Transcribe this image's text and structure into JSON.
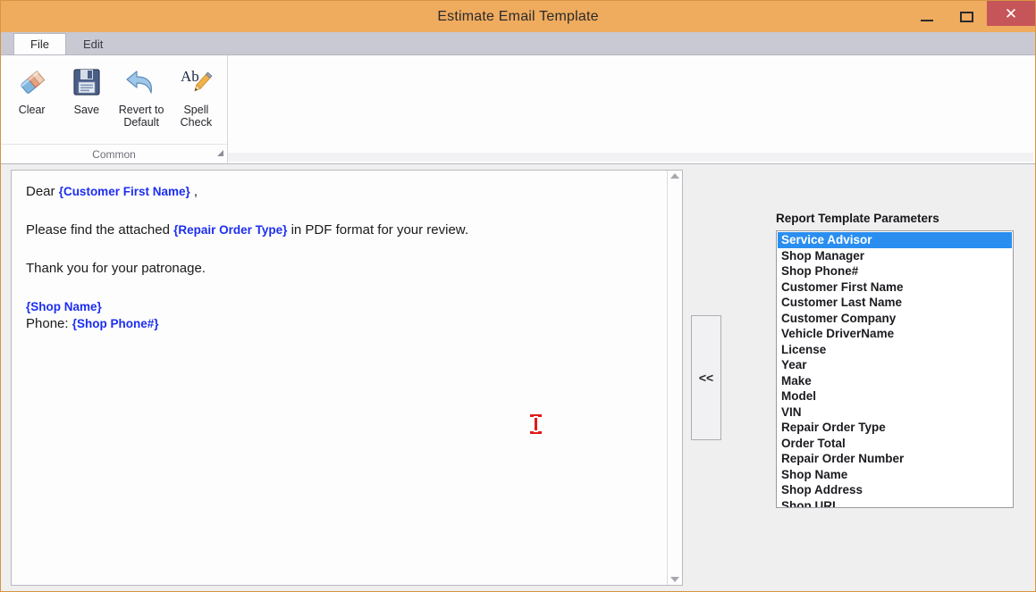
{
  "window": {
    "title": "Estimate Email Template",
    "controls": {
      "minimize": "minimize-button",
      "maximize": "maximize-button",
      "close_label": "✕"
    },
    "frame_color": "#efab5e"
  },
  "ribbon": {
    "tabs": [
      {
        "label": "File",
        "active": true
      },
      {
        "label": "Edit",
        "active": false
      }
    ],
    "group": {
      "label": "Common",
      "buttons": [
        {
          "label": "Clear",
          "icon": "eraser-icon"
        },
        {
          "label": "Save",
          "icon": "floppy-disk-icon"
        },
        {
          "label": "Revert to Default",
          "label_line1": "Revert to",
          "label_line2": "Default",
          "icon": "undo-arrow-icon"
        },
        {
          "label": "Spell Check",
          "label_line1": "Spell",
          "label_line2": "Check",
          "icon": "spell-check-icon"
        }
      ]
    }
  },
  "editor": {
    "paragraphs": [
      {
        "runs": [
          {
            "text": "Dear ",
            "token": false
          },
          {
            "text": "{Customer First Name}",
            "token": true
          },
          {
            "text": " ,",
            "token": false
          }
        ]
      },
      {
        "runs": [
          {
            "text": "Please find the attached ",
            "token": false
          },
          {
            "text": "{Repair Order Type}",
            "token": true
          },
          {
            "text": "  in PDF format for your review.",
            "token": false
          }
        ]
      },
      {
        "runs": [
          {
            "text": "Thank you for your patronage.",
            "token": false
          }
        ]
      }
    ],
    "signature": [
      {
        "runs": [
          {
            "text": "{Shop Name}",
            "token": true
          }
        ]
      },
      {
        "runs": [
          {
            "text": "Phone: ",
            "token": false
          },
          {
            "text": "{Shop Phone#}",
            "token": true
          }
        ]
      }
    ],
    "token_color": "#1c2ef0",
    "caret": "i-beam-cursor"
  },
  "transfer": {
    "label": "<<"
  },
  "parameters": {
    "title": "Report Template Parameters",
    "selected_index": 0,
    "selection_color": "#2a8ef0",
    "items": [
      "Service Advisor",
      "Shop Manager",
      "Shop Phone#",
      "Customer First Name",
      "Customer Last Name",
      "Customer Company",
      "Vehicle DriverName",
      "License",
      "Year",
      "Make",
      "Model",
      "VIN",
      "Repair Order Type",
      "Order Total",
      "Repair Order Number",
      "Shop Name",
      "Shop Address",
      "Shop URL"
    ]
  }
}
